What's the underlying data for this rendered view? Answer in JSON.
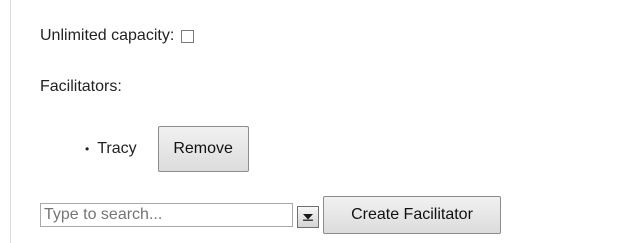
{
  "form": {
    "unlimited_capacity_label": "Unlimited capacity:",
    "unlimited_capacity_checked": false,
    "facilitators_label": "Facilitators:",
    "facilitators": [
      {
        "name": "Tracy",
        "remove_label": "Remove"
      }
    ],
    "search": {
      "placeholder": "Type to search...",
      "value": ""
    },
    "dropdown_icon": "chevron-down-icon",
    "create_facilitator_label": "Create Facilitator"
  }
}
